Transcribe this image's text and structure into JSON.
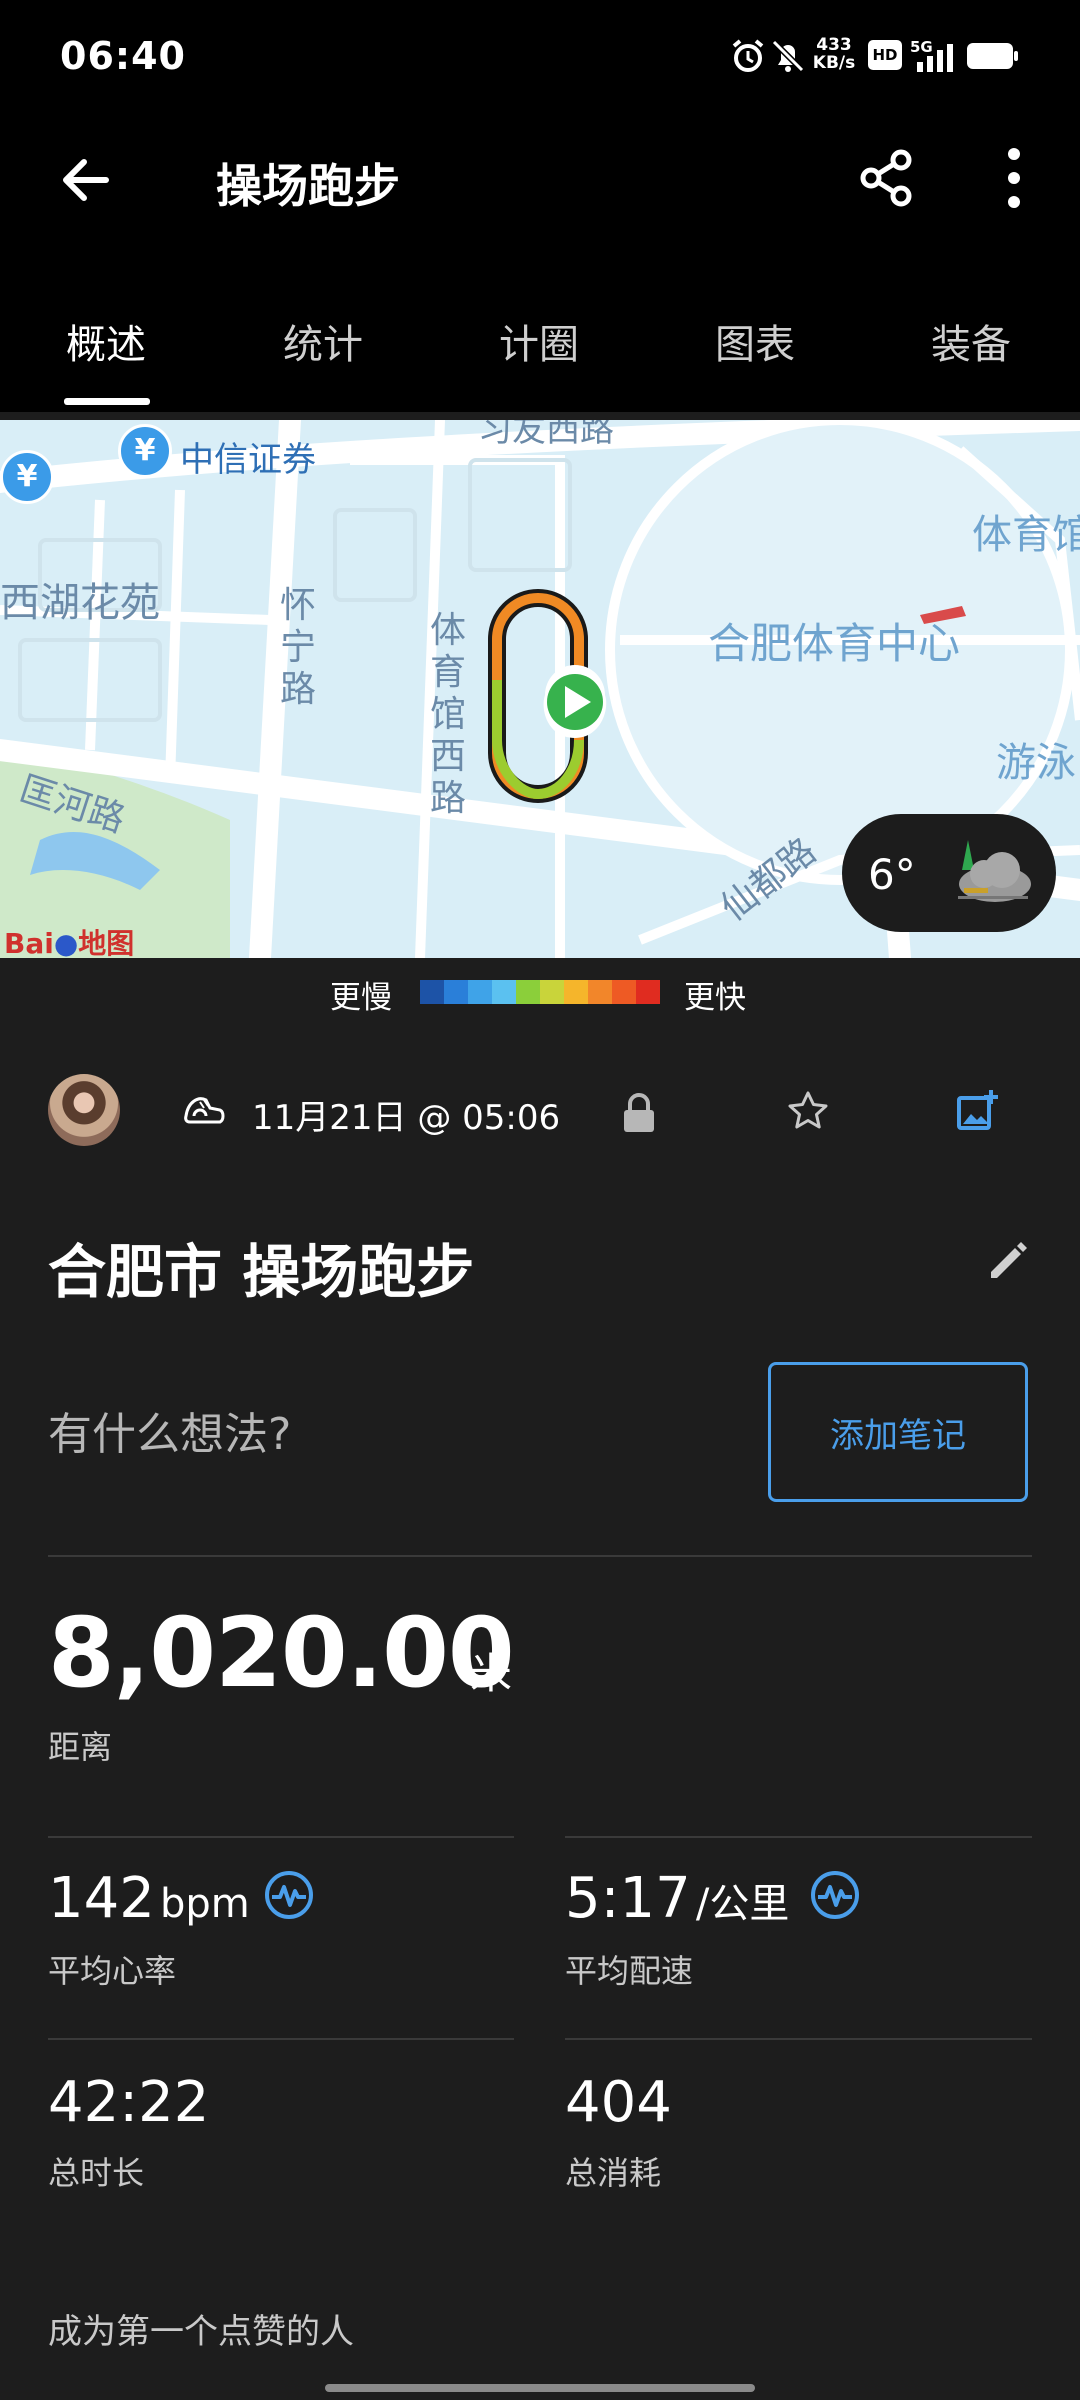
{
  "status_bar": {
    "time": "06:40",
    "net_speed": "433",
    "net_unit": "KB/s",
    "hd": "HD",
    "signal_label": "5G"
  },
  "app_bar": {
    "title": "操场跑步"
  },
  "tabs": [
    {
      "label": "概述",
      "active": true
    },
    {
      "label": "统计"
    },
    {
      "label": "计圈"
    },
    {
      "label": "图表"
    },
    {
      "label": "装备"
    }
  ],
  "map": {
    "labels": {
      "road_top": "习友西路",
      "bank": "中信证券",
      "xihu": "西湖花苑",
      "huaining": "怀宁路",
      "tiyuguan": "体育馆西路",
      "center": "合肥体育中心",
      "tiyu_right": "体育馆",
      "kuanghe": "匡河路",
      "youyong": "游泳",
      "xiandu": "仙都路",
      "baidu": "Bai",
      "baidu_map": "地图"
    },
    "weather": {
      "temperature": "6°",
      "icon": "cloud-icon"
    }
  },
  "legend": {
    "slower": "更慢",
    "faster": "更快",
    "colors": [
      "#1d53a7",
      "#2a7fd9",
      "#3fa3e8",
      "#5bc1f0",
      "#8bcf3a",
      "#c9d43a",
      "#f5b52b",
      "#f2862a",
      "#ee5a24",
      "#e02c20"
    ]
  },
  "activity": {
    "date_time": "11月21日 @ 05:06",
    "name": "合肥市 操场跑步",
    "note_placeholder": "有什么想法?",
    "add_note_label": "添加笔记"
  },
  "distance": {
    "value": "8,020.00",
    "unit": "米",
    "label": "距离"
  },
  "stats": [
    {
      "value": "142",
      "unit": "bpm",
      "label": "平均心率",
      "has_icon": true
    },
    {
      "value": "5:17",
      "unit": "/公里",
      "label": "平均配速",
      "has_icon": true
    },
    {
      "value": "42:22",
      "unit": "",
      "label": "总时长",
      "has_icon": false
    },
    {
      "value": "404",
      "unit": "",
      "label": "总消耗",
      "has_icon": false
    }
  ],
  "likes_text": "成为第一个点赞的人",
  "colors": {
    "accent": "#4a9eea",
    "background": "#1d1d1d",
    "bar": "#000000"
  }
}
